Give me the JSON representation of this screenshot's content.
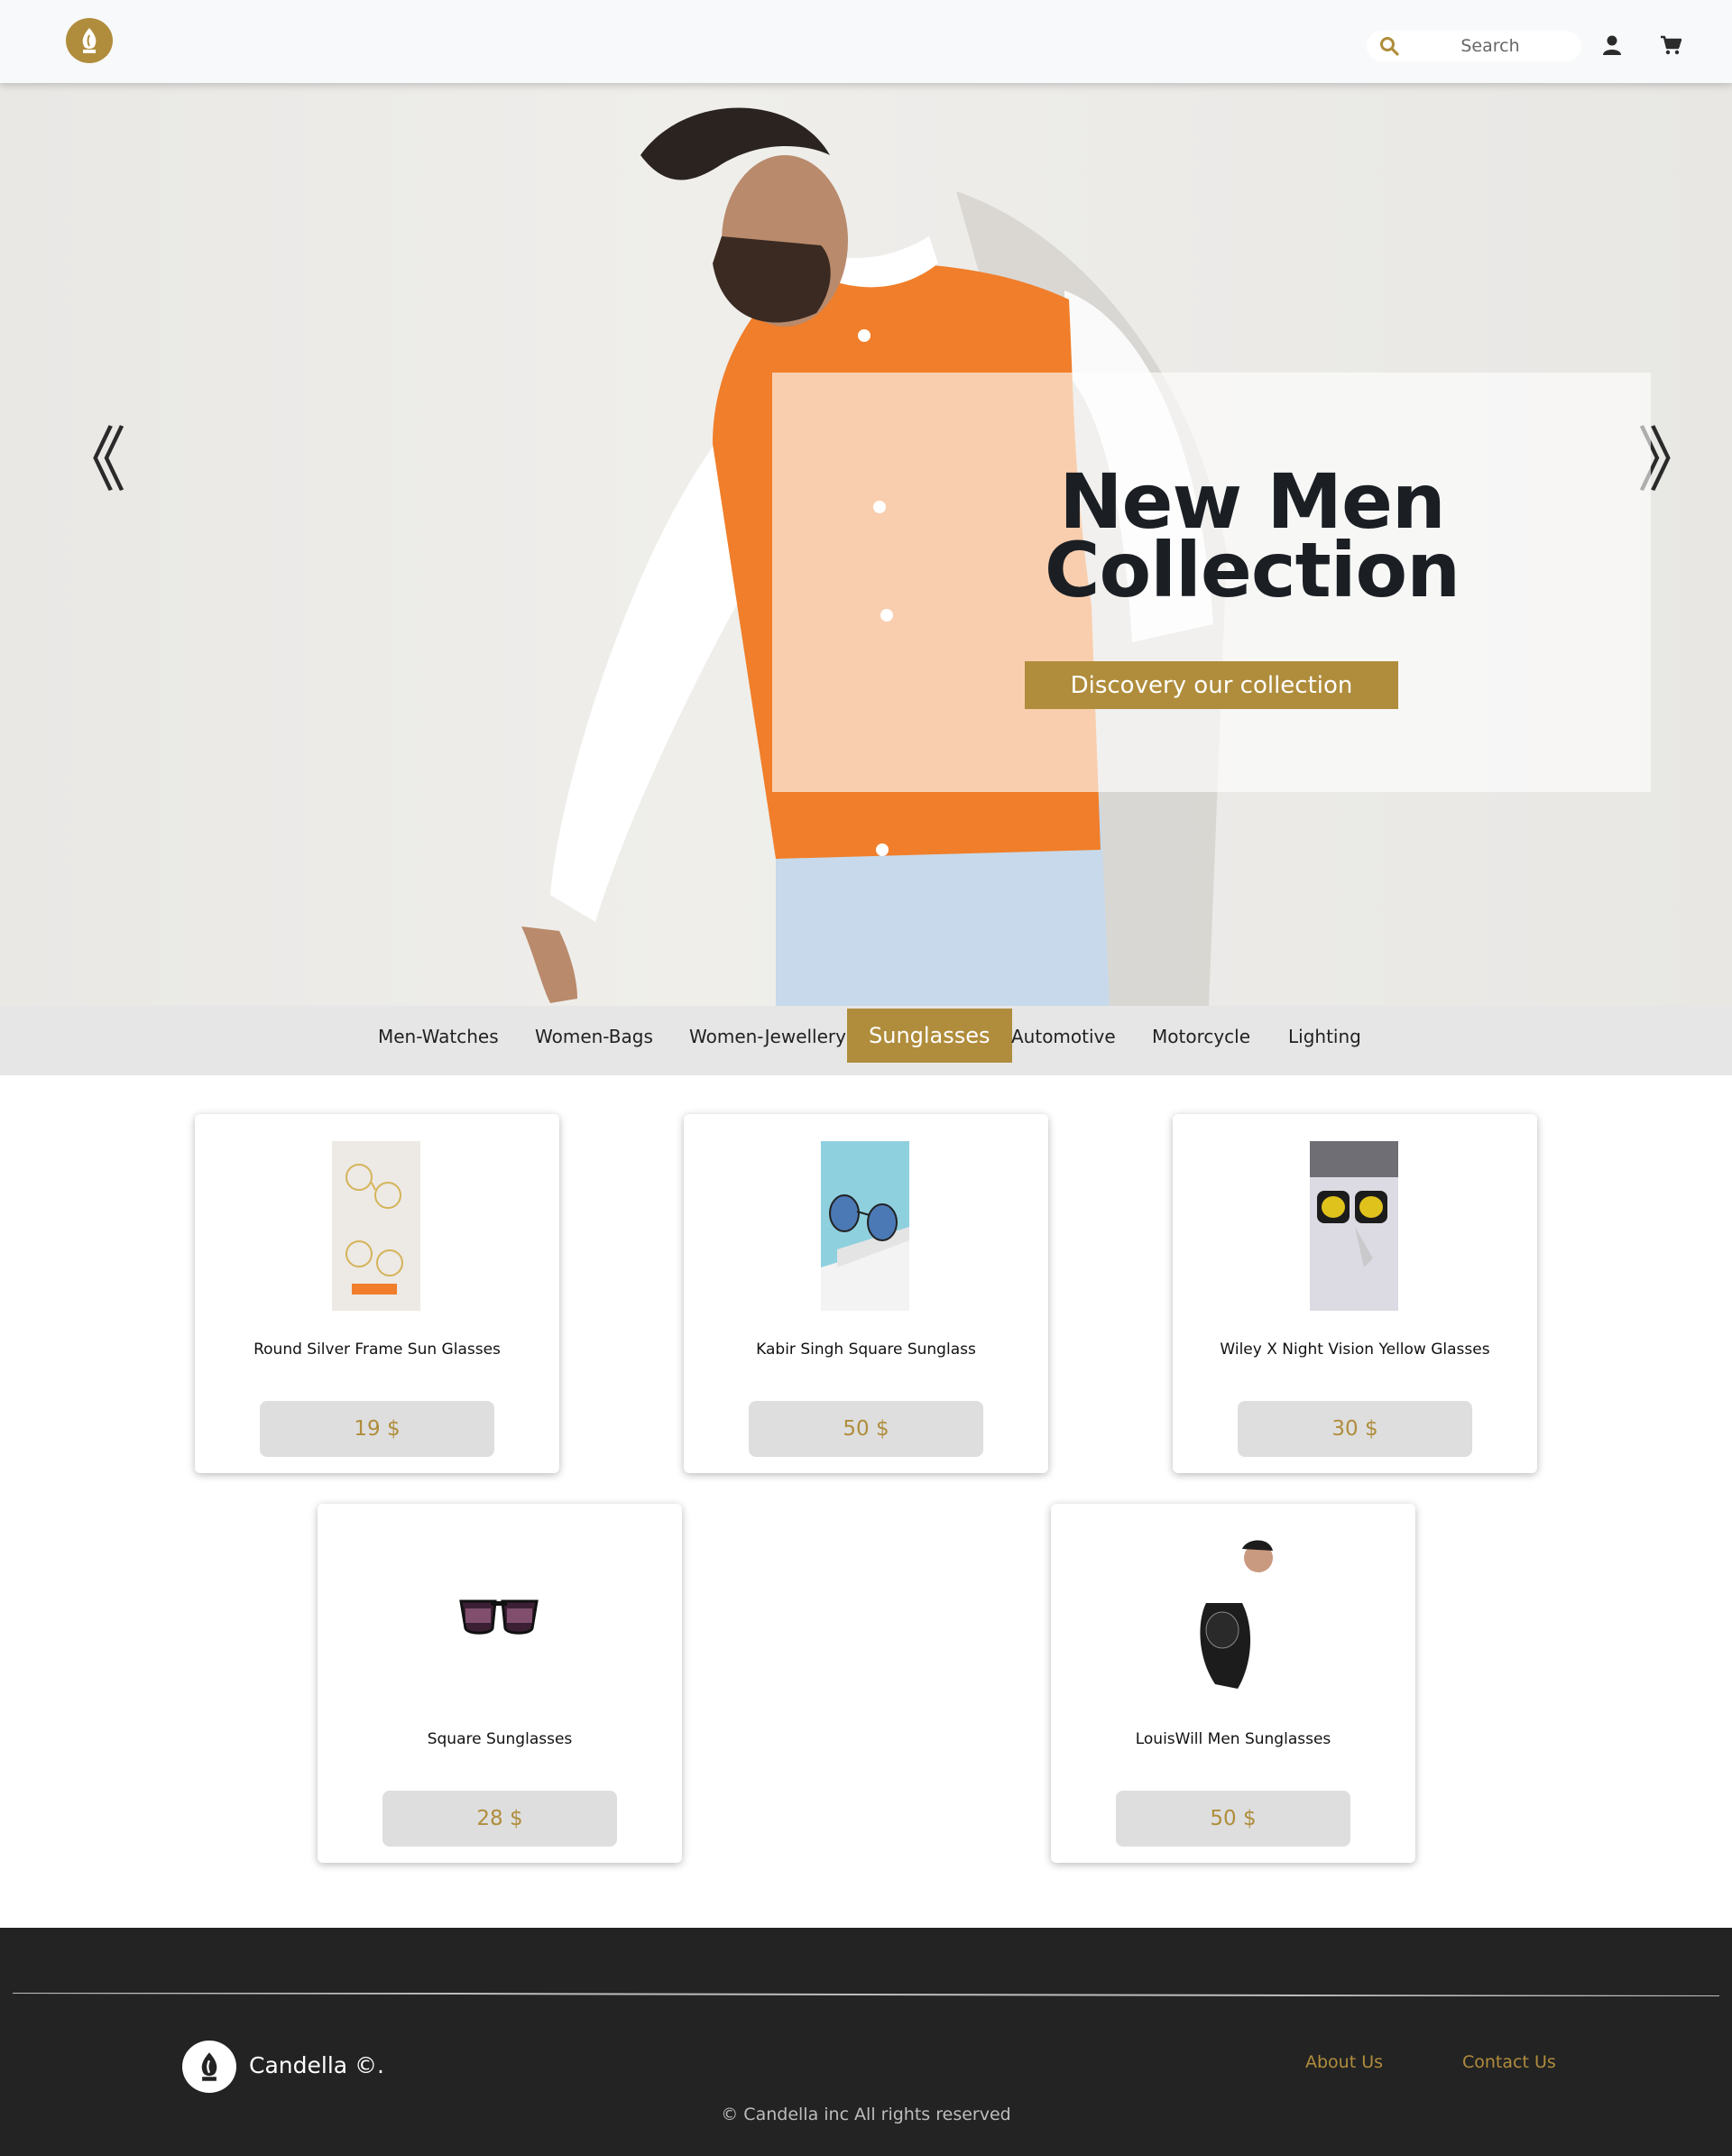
{
  "brand": {
    "accent_color": "#b08d3c",
    "logo_icon": "leaf-flame-icon"
  },
  "header": {
    "search": {
      "placeholder": "Search",
      "icon": "search-icon"
    },
    "user_icon": "user-icon",
    "cart_icon": "cart-icon"
  },
  "hero": {
    "prev_arrow": "《",
    "next_arrow": "》",
    "title_line1": "New Men",
    "title_line2": "Collection",
    "cta_label": "Discovery our collection"
  },
  "categories": [
    {
      "label": "Men-Watches",
      "active": false
    },
    {
      "label": "Women-Bags",
      "active": false
    },
    {
      "label": "Women-Jewellery",
      "active": false
    },
    {
      "label": "Sunglasses",
      "active": true
    },
    {
      "label": "Automotive",
      "active": false
    },
    {
      "label": "Motorcycle",
      "active": false
    },
    {
      "label": "Lighting",
      "active": false
    }
  ],
  "products": [
    {
      "name": "Round Silver Frame Sun Glasses",
      "price": "19 $"
    },
    {
      "name": "Kabir Singh Square Sunglass",
      "price": "50 $"
    },
    {
      "name": "Wiley X Night Vision Yellow Glasses",
      "price": "30 $"
    },
    {
      "name": "Square Sunglasses",
      "price": "28 $"
    },
    {
      "name": "LouisWill Men Sunglasses",
      "price": "50 $"
    }
  ],
  "footer": {
    "brand": "Candella ©.",
    "about_label": "About Us",
    "contact_label": "Contact Us",
    "copyright": "© Candella inc All rights reserved"
  }
}
